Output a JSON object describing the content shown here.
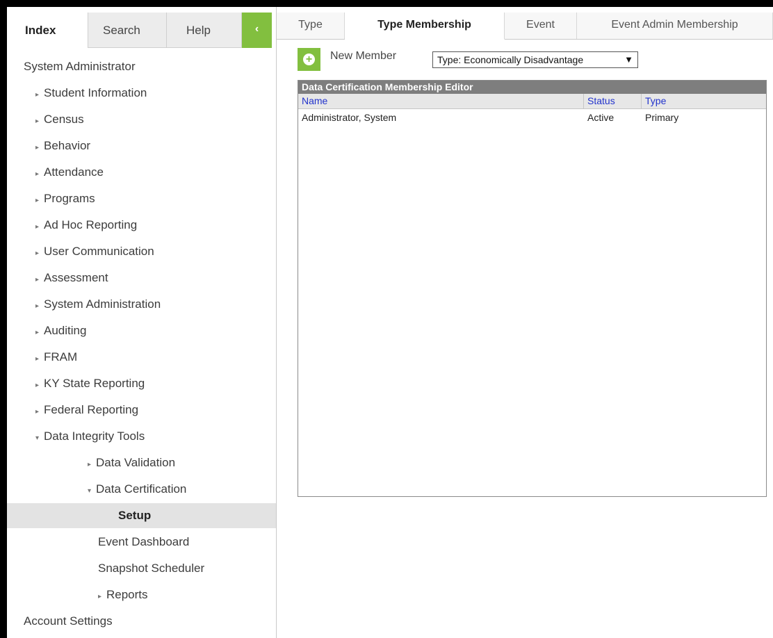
{
  "nav": {
    "tabs": [
      {
        "label": "Index",
        "active": true
      },
      {
        "label": "Search",
        "active": false
      },
      {
        "label": "Help",
        "active": false
      }
    ],
    "collapse_icon": "chevron-left-icon",
    "tree": [
      {
        "label": "System Administrator",
        "indent": 0,
        "arrow": ""
      },
      {
        "label": "Student Information",
        "indent": 1,
        "arrow": "▸"
      },
      {
        "label": "Census",
        "indent": 1,
        "arrow": "▸"
      },
      {
        "label": "Behavior",
        "indent": 1,
        "arrow": "▸"
      },
      {
        "label": "Attendance",
        "indent": 1,
        "arrow": "▸"
      },
      {
        "label": "Programs",
        "indent": 1,
        "arrow": "▸"
      },
      {
        "label": "Ad Hoc Reporting",
        "indent": 1,
        "arrow": "▸"
      },
      {
        "label": "User Communication",
        "indent": 1,
        "arrow": "▸"
      },
      {
        "label": "Assessment",
        "indent": 1,
        "arrow": "▸"
      },
      {
        "label": "System Administration",
        "indent": 1,
        "arrow": "▸"
      },
      {
        "label": "Auditing",
        "indent": 1,
        "arrow": "▸"
      },
      {
        "label": "FRAM",
        "indent": 1,
        "arrow": "▸"
      },
      {
        "label": "KY State Reporting",
        "indent": 1,
        "arrow": "▸"
      },
      {
        "label": "Federal Reporting",
        "indent": 1,
        "arrow": "▸"
      },
      {
        "label": "Data Integrity Tools",
        "indent": 1,
        "arrow": "▾"
      },
      {
        "label": "Data Validation",
        "indent": 2,
        "arrow": "▸"
      },
      {
        "label": "Data Certification",
        "indent": 2,
        "arrow": "▾"
      },
      {
        "label": "Setup",
        "indent": 3,
        "arrow": "",
        "selected": true
      },
      {
        "label": "Event Dashboard",
        "indent": 3,
        "arrow": ""
      },
      {
        "label": "Snapshot Scheduler",
        "indent": 3,
        "arrow": ""
      },
      {
        "label": "Reports",
        "indent": 3,
        "arrow": "▸"
      },
      {
        "label": "Account Settings",
        "indent": 0,
        "arrow": ""
      }
    ]
  },
  "content": {
    "tabs": [
      {
        "label": "Type",
        "active": false
      },
      {
        "label": "Type Membership",
        "active": true
      },
      {
        "label": "Event",
        "active": false
      },
      {
        "label": "Event Admin Membership",
        "active": false
      }
    ],
    "new_member_label": "New Member",
    "add_icon": "plus-circle-icon",
    "type_select": {
      "value": "Type: Economically Disadvantage",
      "caret": "▼"
    },
    "grid": {
      "title": "Data Certification Membership Editor",
      "columns": [
        "Name",
        "Status",
        "Type"
      ],
      "rows": [
        {
          "name": "Administrator, System",
          "status": "Active",
          "type": "Primary"
        }
      ]
    }
  },
  "colors": {
    "accent_green": "#82bf3f",
    "header_link": "#2233cc",
    "grid_title_bg": "#7e7e7e"
  }
}
